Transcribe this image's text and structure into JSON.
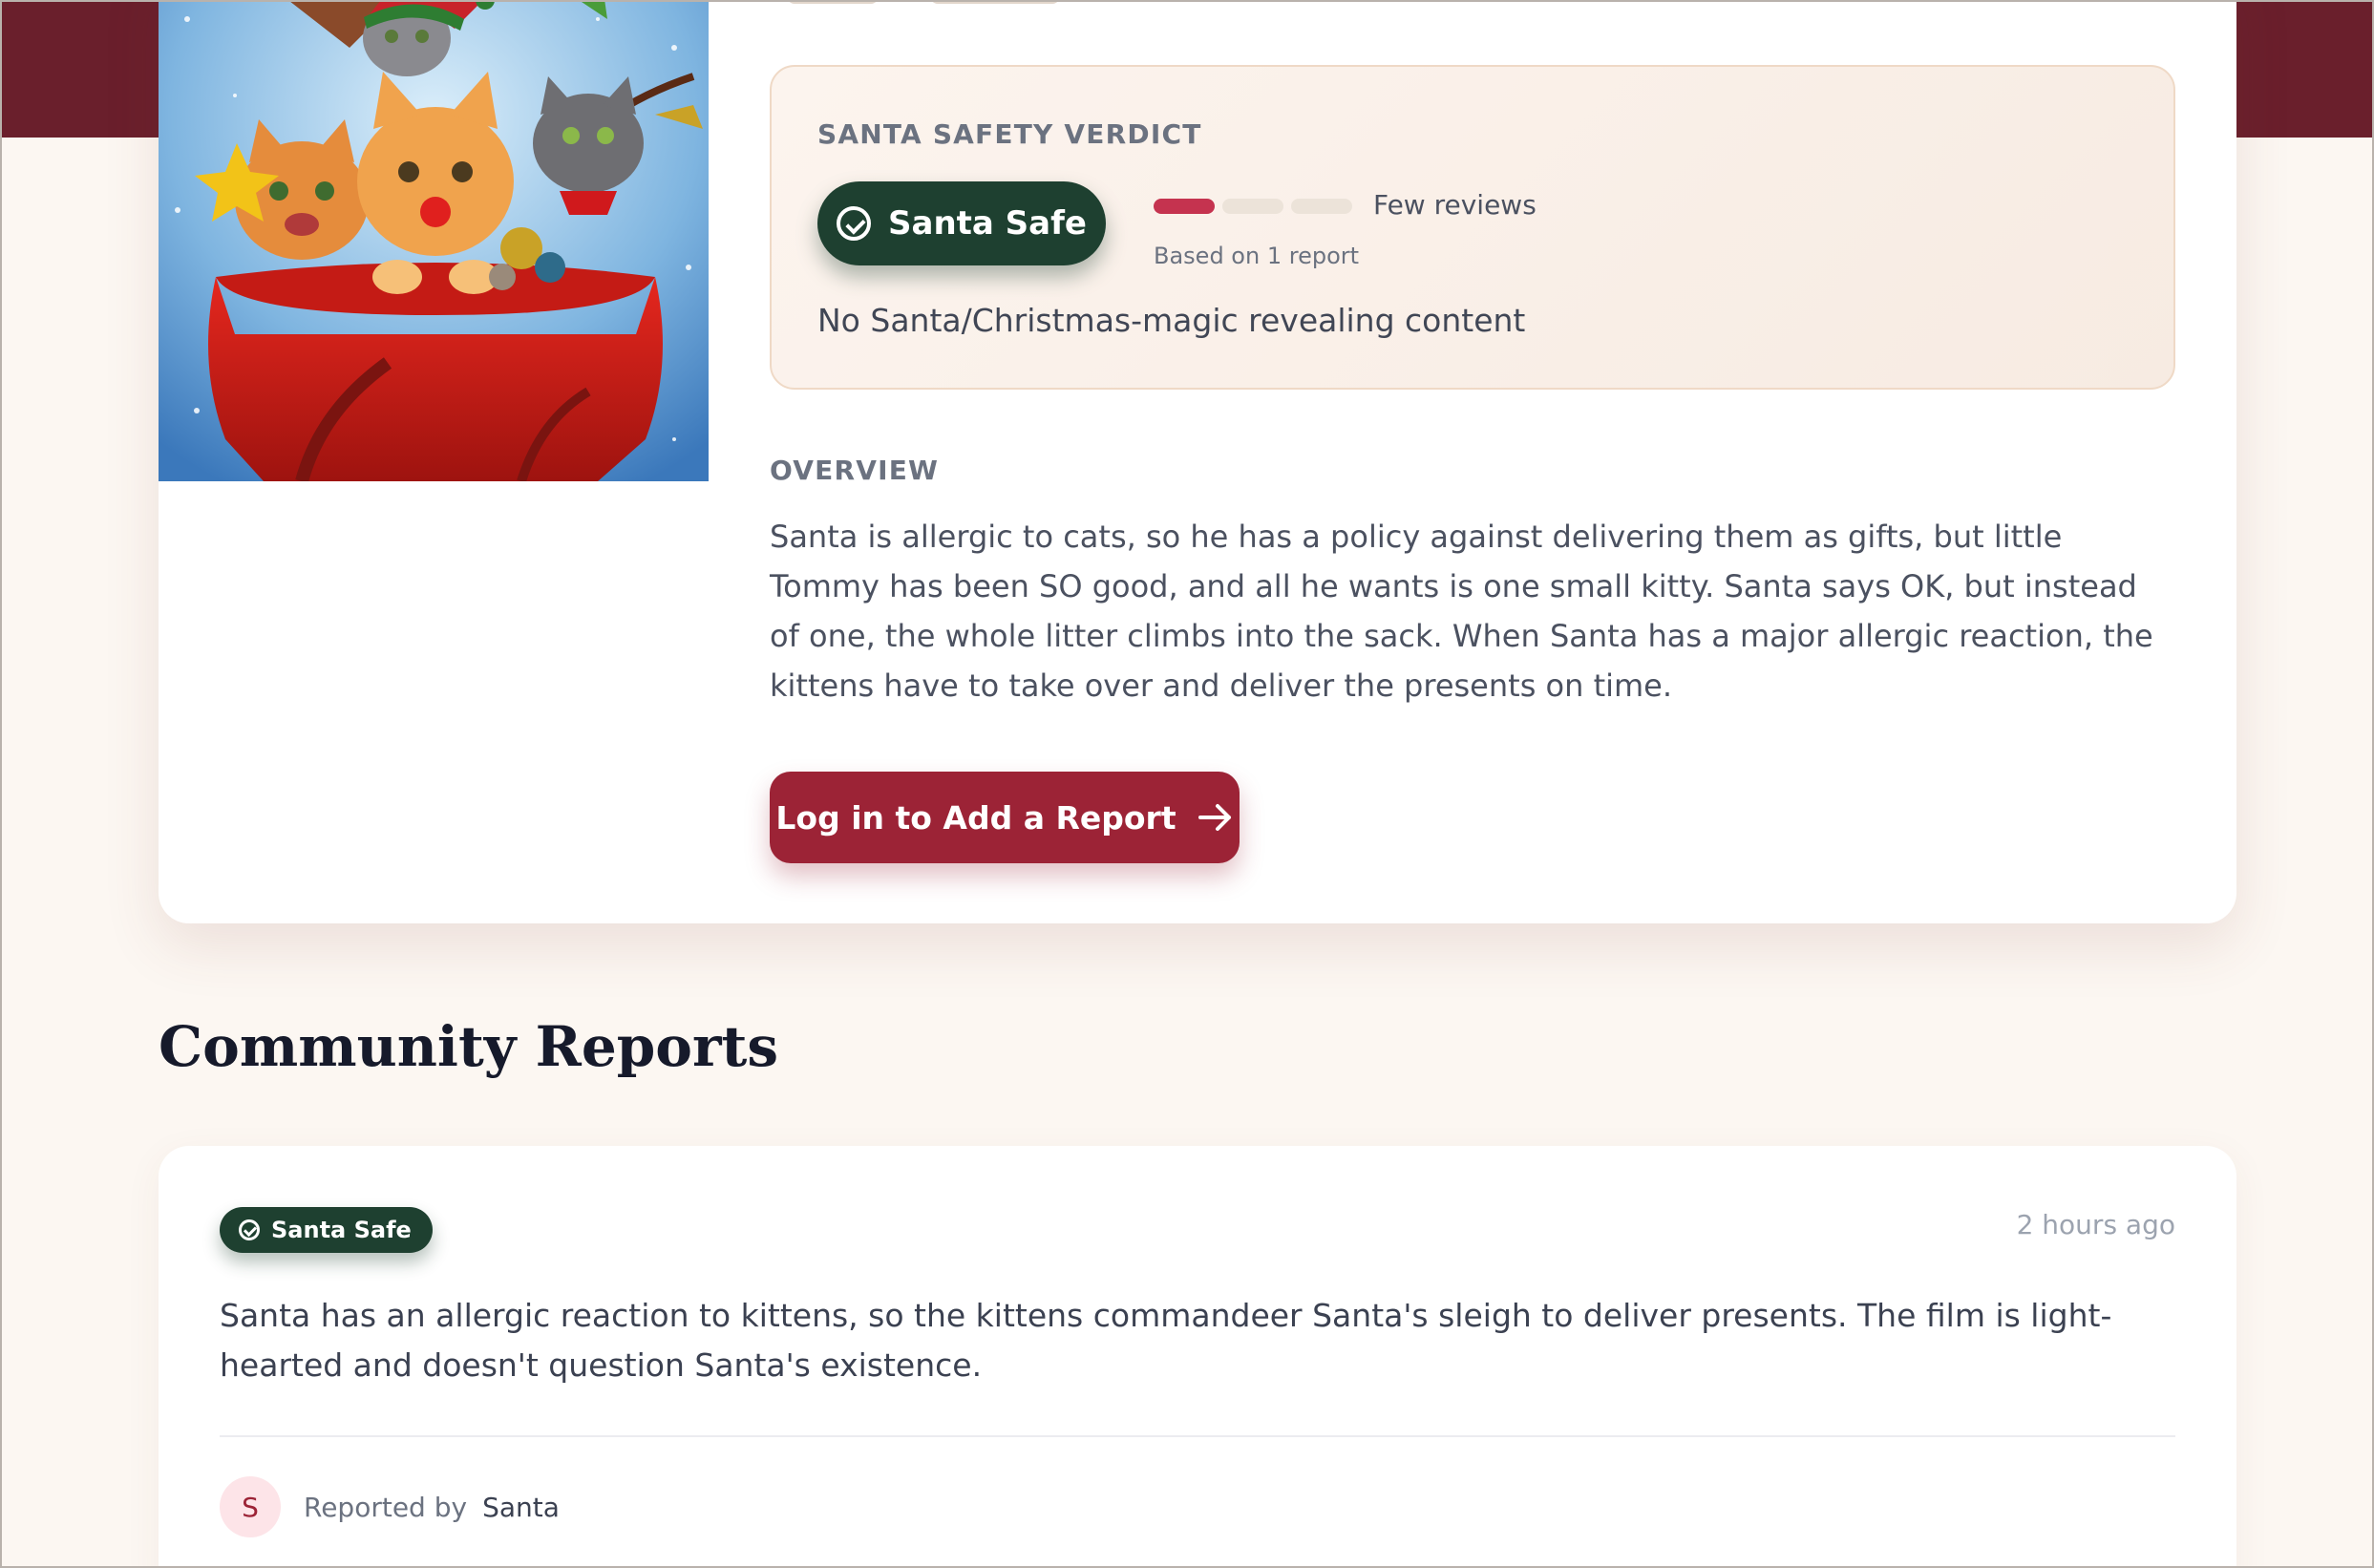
{
  "colors": {
    "brand_dark": "#6a1f2c",
    "safe_green": "#1e4030",
    "cta_red": "#9c2336",
    "meter_active": "#c5334f",
    "page_bg": "#fcf7f2"
  },
  "poster": {
    "alt": "Movie poster: kittens in Santa's red sack"
  },
  "verdict": {
    "heading": "SANTA SAFETY VERDICT",
    "badge_label": "Santa Safe",
    "badge_icon": "check-circle-icon",
    "confidence_level": 1,
    "confidence_max": 3,
    "reviews_label": "Few reviews",
    "based_on": "Based on 1 report",
    "note": "No Santa/Christmas-magic revealing content"
  },
  "overview": {
    "heading": "OVERVIEW",
    "text": "Santa is allergic to cats, so he has a policy against delivering them as gifts, but little Tommy has been SO good, and all he wants is one small kitty. Santa says OK, but instead of one, the whole litter climbs into the sack. When Santa has a major allergic reaction, the kittens have to take over and deliver the presents on time."
  },
  "cta": {
    "label": "Log in to Add a Report",
    "icon": "arrow-right-icon"
  },
  "community": {
    "title": "Community Reports",
    "reports": [
      {
        "badge": "Santa Safe",
        "time": "2 hours ago",
        "text": "Santa has an allergic reaction to kittens, so the kittens commandeer Santa's sleigh to deliver presents. The film is light-hearted and doesn't question Santa's existence.",
        "reported_by_label": "Reported by",
        "reporter_name": "Santa",
        "reporter_initial": "S"
      }
    ]
  }
}
